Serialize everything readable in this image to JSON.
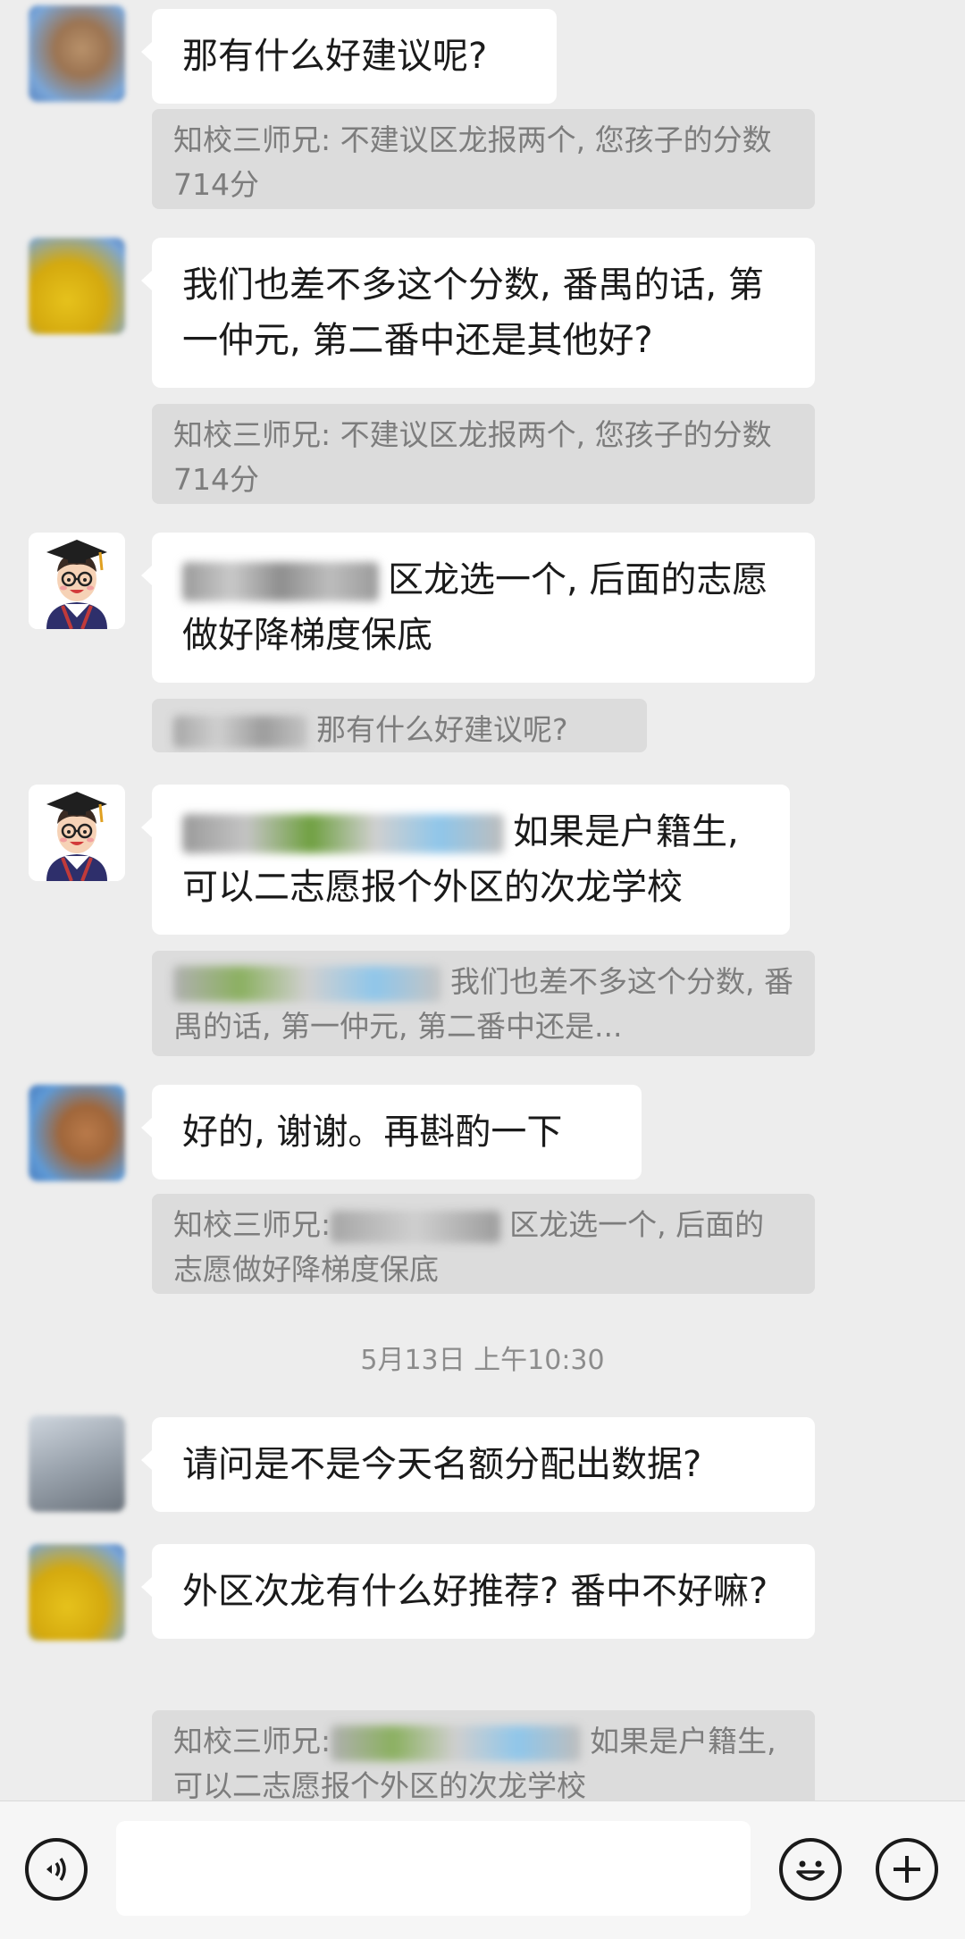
{
  "messages": [
    {
      "type": "incoming",
      "avatar": "user-avatar-1",
      "text": "那有什么好建议呢?",
      "quote": "知校三师兄: 不建议区龙报两个, 您孩子的分数714分"
    },
    {
      "type": "incoming",
      "avatar": "user-avatar-2",
      "text": "我们也差不多这个分数, 番禺的话, 第一仲元, 第二番中还是其他好?",
      "quote": "知校三师兄: 不建议区龙报两个, 您孩子的分数714分"
    },
    {
      "type": "outgoing-bot",
      "avatar": "cartoon-graduate-avatar",
      "text": "区龙选一个, 后面的志愿做好降梯度保底",
      "quote": "那有什么好建议呢?"
    },
    {
      "type": "outgoing-bot",
      "avatar": "cartoon-graduate-avatar",
      "text": "如果是户籍生, 可以二志愿报个外区的次龙学校",
      "quote": "我们也差不多这个分数, 番禺的话, 第一仲元, 第二番中还是..."
    },
    {
      "type": "incoming",
      "avatar": "user-avatar-3",
      "text": "好的, 谢谢。再斟酌一下",
      "quote_prefix": "知校三师兄:",
      "quote": "区龙选一个, 后面的志愿做好降梯度保底"
    }
  ],
  "timestamp": "5月13日 上午10:30",
  "messages_after": [
    {
      "avatar": "user-avatar-4",
      "text": "请问是不是今天名额分配出数据?"
    },
    {
      "avatar": "user-avatar-2",
      "text": "外区次龙有什么好推荐? 番中不好嘛?",
      "quote_prefix": "知校三师兄:",
      "quote": "如果是户籍生, 可以二志愿报个外区的次龙学校"
    }
  ],
  "input_bar": {
    "voice_icon": "voice-icon",
    "emoji_icon": "emoji-icon",
    "plus_icon": "plus-icon",
    "input_value": ""
  },
  "colors": {
    "background": "#ededed",
    "bubble": "#ffffff",
    "quote": "#dcdcdc",
    "quote_text": "#7d7d7d"
  }
}
